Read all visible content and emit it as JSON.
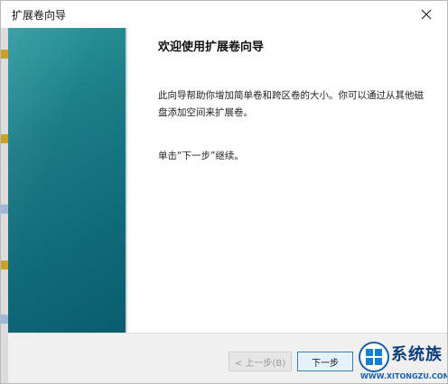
{
  "window": {
    "title": "扩展卷向导"
  },
  "page": {
    "heading": "欢迎使用扩展卷向导",
    "description": "此向导帮助你增加简单卷和跨区卷的大小。你可以通过从其他磁盘添加空间来扩展卷。",
    "instruction": "单击“下一步”继续。"
  },
  "buttons": {
    "back_label": "< 上一步(B)",
    "next_label": "下一步"
  },
  "watermark": {
    "title": "系统族",
    "url": "WWW.XITONGZU.COM"
  },
  "colors": {
    "side_panel": "#1b7c86",
    "watermark_blue": "#0f3f7a"
  }
}
